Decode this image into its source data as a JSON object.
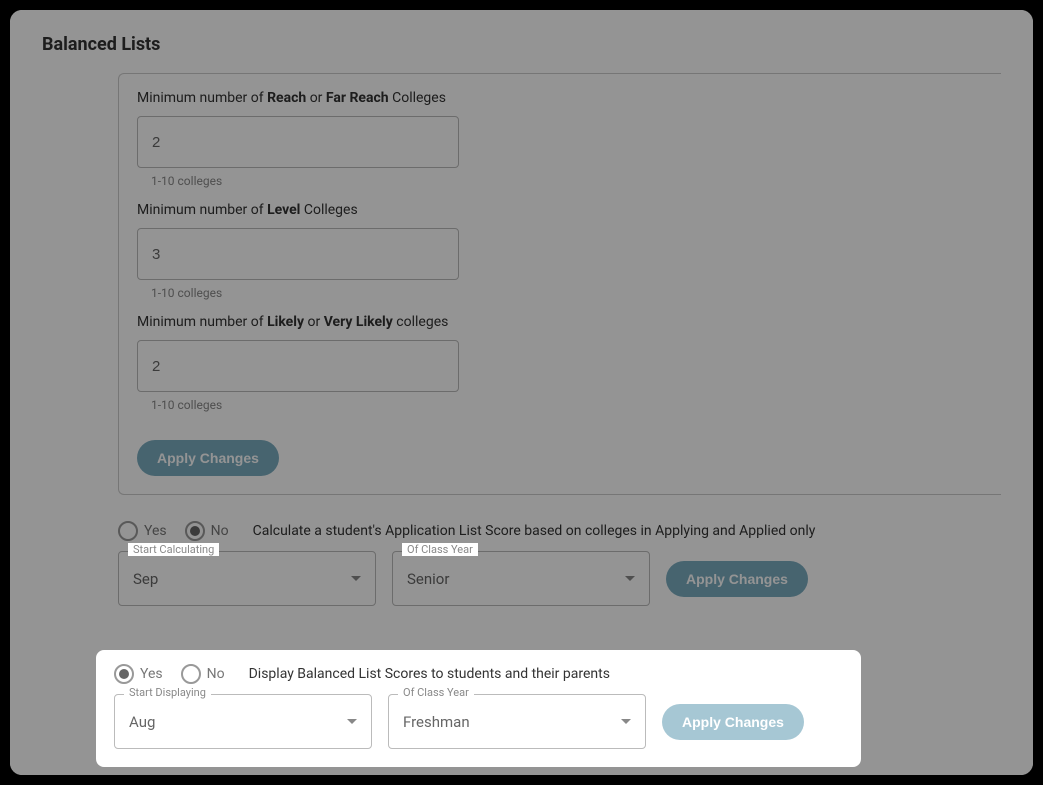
{
  "sectionTitle": "Balanced Lists",
  "reach": {
    "labelPrefix": "Minimum number of ",
    "bold1": "Reach",
    "mid": " or ",
    "bold2": "Far Reach",
    "suffix": " Colleges",
    "value": "2",
    "helper": "1-10 colleges"
  },
  "level": {
    "labelPrefix": "Minimum number of ",
    "bold1": "Level",
    "suffix": " Colleges",
    "value": "3",
    "helper": "1-10 colleges"
  },
  "likely": {
    "labelPrefix": "Minimum number of ",
    "bold1": "Likely",
    "mid": " or ",
    "bold2": "Very Likely",
    "suffix": " colleges",
    "value": "2",
    "helper": "1-10 colleges"
  },
  "applyChangesLabel": "Apply Changes",
  "calc": {
    "yes": "Yes",
    "no": "No",
    "description": "Calculate a student's Application List Score based on colleges in Applying and Applied only",
    "startLabel": "Start Calculating",
    "startValue": "Sep",
    "yearLabel": "Of Class Year",
    "yearValue": "Senior"
  },
  "display": {
    "yes": "Yes",
    "no": "No",
    "description": "Display Balanced List Scores to students and their parents",
    "startLabel": "Start Displaying",
    "startValue": "Aug",
    "yearLabel": "Of Class Year",
    "yearValue": "Freshman"
  }
}
